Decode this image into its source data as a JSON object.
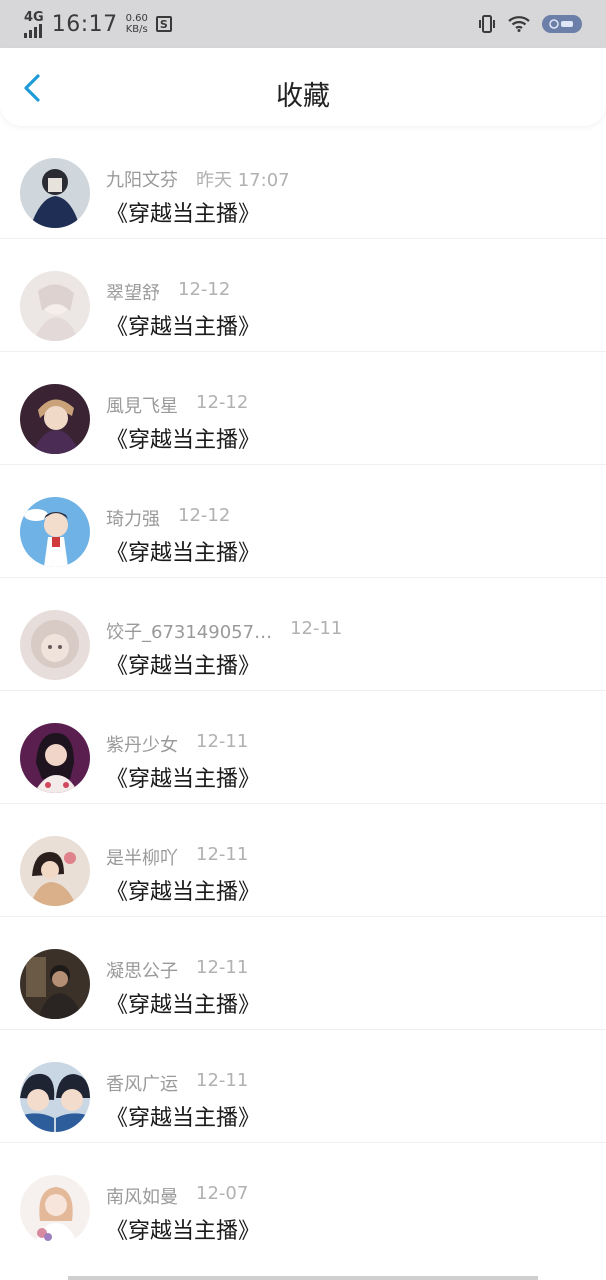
{
  "status_bar": {
    "network": "4G",
    "time": "16:17",
    "speed_value": "0.60",
    "speed_unit": "KB/s",
    "app_badge": "S",
    "icons": [
      "vibrate-icon",
      "wifi-icon",
      "battery-icon"
    ]
  },
  "header": {
    "title": "收藏",
    "back_icon": "chevron-left-icon"
  },
  "favorites": [
    {
      "user": "九阳文芬",
      "time": "昨天 17:07",
      "title": "《穿越当主播》"
    },
    {
      "user": "翠望舒",
      "time": "12-12",
      "title": "《穿越当主播》"
    },
    {
      "user": "風見飞星",
      "time": "12-12",
      "title": "《穿越当主播》"
    },
    {
      "user": "琦力强",
      "time": "12-12",
      "title": "《穿越当主播》"
    },
    {
      "user": "饺子_673149057…",
      "time": "12-11",
      "title": "《穿越当主播》"
    },
    {
      "user": "紫丹少女",
      "time": "12-11",
      "title": "《穿越当主播》"
    },
    {
      "user": "是半柳吖",
      "time": "12-11",
      "title": "《穿越当主播》"
    },
    {
      "user": "凝思公子",
      "time": "12-11",
      "title": "《穿越当主播》"
    },
    {
      "user": "香风广运",
      "time": "12-11",
      "title": "《穿越当主播》"
    },
    {
      "user": "南风如曼",
      "time": "12-07",
      "title": "《穿越当主播》"
    }
  ],
  "colors": {
    "accent": "#1e9bd8",
    "status_bar": "#d7d7d9"
  }
}
